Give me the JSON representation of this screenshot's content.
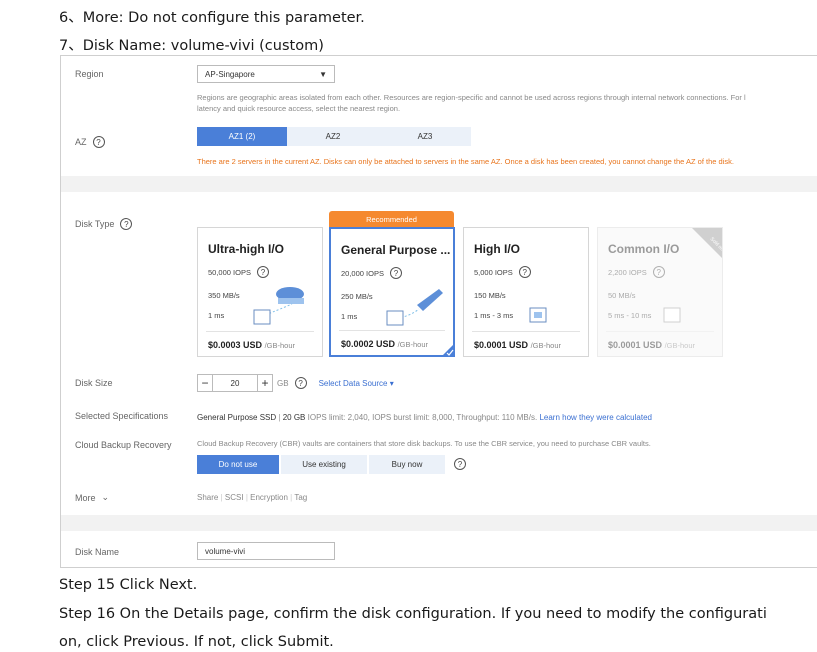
{
  "doc": {
    "line1": "6、More: Do not configure this parameter.",
    "line2": "7、Disk Name: volume-vivi (custom)",
    "step15": "Step 15 Click Next.",
    "step16_a": "Step 16 On the Details page, confirm the disk configuration. If you need to modify the configurati",
    "step16_b": "on, click Previous. If not, click Submit."
  },
  "form": {
    "region": {
      "label": "Region",
      "value": "AP-Singapore",
      "desc1": "Regions are geographic areas isolated from each other. Resources are region-specific and cannot be used across regions through internal network connections. For l",
      "desc2": "latency and quick resource access, select the nearest region."
    },
    "az": {
      "label": "AZ",
      "options": [
        "AZ1 (2)",
        "AZ2",
        "AZ3"
      ],
      "warning": "There are 2 servers in the current AZ. Disks can only be attached to servers in the same AZ. Once a disk has been created, you cannot change the AZ of the disk."
    },
    "disk_type": {
      "label": "Disk Type",
      "badge": "Recommended",
      "cards": [
        {
          "title": "Ultra-high I/O",
          "iops": "50,000 IOPS",
          "throughput": "350 MB/s",
          "latency": "1 ms",
          "price": "$0.0003 USD",
          "unit": "/GB-hour"
        },
        {
          "title": "General Purpose ...",
          "iops": "20,000 IOPS",
          "throughput": "250 MB/s",
          "latency": "1 ms",
          "price": "$0.0002 USD",
          "unit": "/GB-hour"
        },
        {
          "title": "High I/O",
          "iops": "5,000 IOPS",
          "throughput": "150 MB/s",
          "latency": "1 ms - 3 ms",
          "price": "$0.0001 USD",
          "unit": "/GB-hour"
        },
        {
          "title": "Common I/O",
          "iops": "2,200 IOPS",
          "throughput": "50 MB/s",
          "latency": "5 ms - 10 ms",
          "price": "$0.0001 USD",
          "unit": "/GB-hour",
          "corner": "Sold out"
        }
      ]
    },
    "disk_size": {
      "label": "Disk Size",
      "minus": "−",
      "value": "20",
      "plus": "+",
      "unit": "GB",
      "data_source": "Select Data Source"
    },
    "specs": {
      "label": "Selected Specifications",
      "type": "General Purpose SSD",
      "size": "20 GB",
      "details": "IOPS limit: 2,040, IOPS burst limit: 8,000, Throughput: 110 MB/s.",
      "link": "Learn how they were calculated"
    },
    "cbr": {
      "label": "Cloud Backup Recovery",
      "desc": "Cloud Backup Recovery (CBR) vaults are containers that store disk backups. To use the CBR service, you need to purchase CBR vaults.",
      "options": [
        "Do not use",
        "Use existing",
        "Buy now"
      ]
    },
    "more": {
      "label": "More",
      "items": [
        "Share",
        "SCSI",
        "Encryption",
        "Tag"
      ]
    },
    "disk_name": {
      "label": "Disk Name",
      "value": "volume-vivi"
    }
  },
  "colors": {
    "accent": "#4a7fd8",
    "warning": "#e8741c",
    "badge": "#f5892f"
  }
}
